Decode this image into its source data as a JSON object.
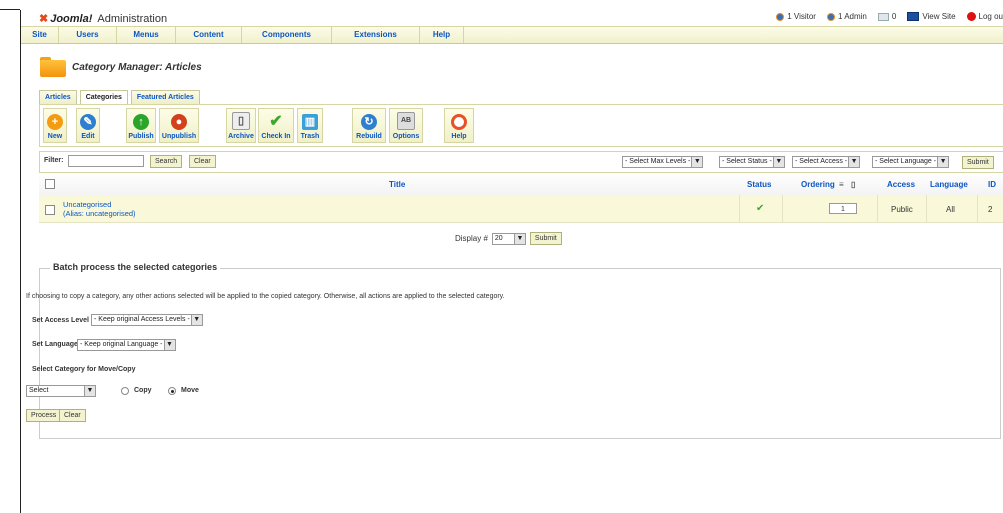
{
  "brand": {
    "title": "Administration"
  },
  "status": {
    "visitors": "1 Visitor",
    "admins": "1 Admin",
    "messages": "0",
    "view_site": "View Site",
    "logout": "Log ou"
  },
  "menu": [
    "Site",
    "Users",
    "Menus",
    "Content",
    "Components",
    "Extensions",
    "Help"
  ],
  "page": {
    "title": "Category Manager: Articles"
  },
  "subtabs": [
    "Articles",
    "Categories",
    "Featured Articles"
  ],
  "toolbar": {
    "new": "New",
    "edit": "Edit",
    "publish": "Publish",
    "unpublish": "Unpublish",
    "archive": "Archive",
    "checkin": "Check In",
    "trash": "Trash",
    "rebuild": "Rebuild",
    "options": "Options",
    "help": "Help"
  },
  "filter": {
    "label": "Filter:",
    "search": "Search",
    "clear": "Clear",
    "max_levels": "- Select Max Levels -",
    "status": "- Select Status -",
    "access": "- Select Access -",
    "language": "- Select Language -",
    "submit": "Submit"
  },
  "table": {
    "headers": {
      "title": "Title",
      "status": "Status",
      "ordering": "Ordering",
      "access": "Access",
      "language": "Language",
      "id": "ID"
    },
    "rows": [
      {
        "title": "Uncategorised",
        "alias": "(Alias: uncategorised)",
        "status_icon": "check-icon",
        "ordering": "1",
        "access": "Public",
        "language": "All",
        "id": "2"
      }
    ]
  },
  "pager": {
    "label": "Display #",
    "value": "20",
    "submit": "Submit"
  },
  "batch": {
    "legend": "Batch process the selected categories",
    "note": "If choosing to copy a category, any other actions selected will be applied to the copied category. Otherwise, all actions are applied to the selected category.",
    "access_label": "Set Access Level",
    "access_value": "- Keep original Access Levels -",
    "language_label": "Set Language",
    "language_value": "- Keep original Language -",
    "move_label": "Select Category for Move/Copy",
    "move_value": "Select",
    "copy": "Copy",
    "move": "Move",
    "process": "Process",
    "clear": "Clear"
  },
  "colors": {
    "link": "#0b55c4",
    "menu_bg": "#f1f1cc",
    "row_bg": "#f9f9d9",
    "check": "#3fa82b"
  }
}
